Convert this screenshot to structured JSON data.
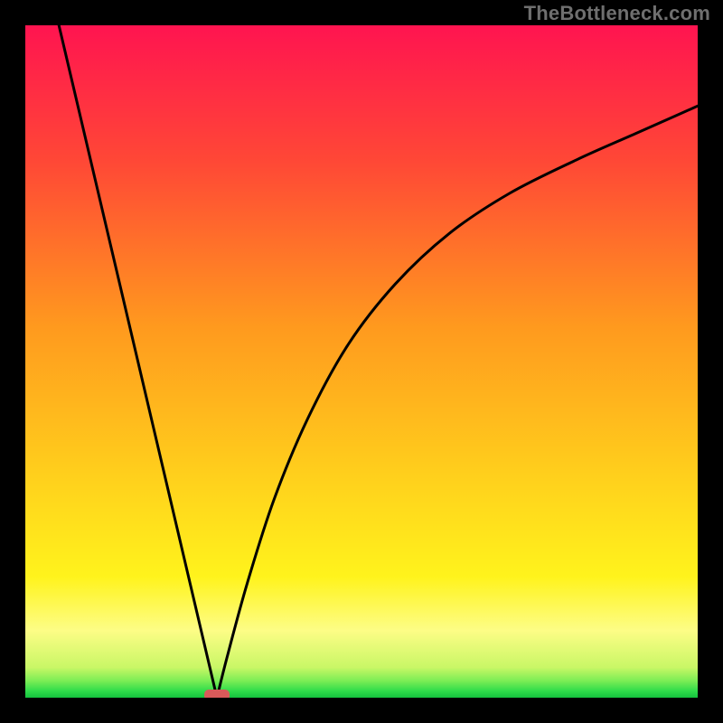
{
  "watermark": "TheBottleneck.com",
  "chart_data": {
    "type": "line",
    "title": "",
    "xlabel": "",
    "ylabel": "",
    "xlim": [
      0,
      100
    ],
    "ylim": [
      0,
      100
    ],
    "grid": false,
    "legend": false,
    "notes": "V-shaped curve: left branch is a straight line from (~5,100) down to a minimum at x≈28; right branch rises as a concave curve approaching ~88 at x=100. Background is a vertical gradient red→orange→yellow→green with a thin green band at the very bottom. A small red rounded marker sits at the minimum.",
    "marker": {
      "x": 28.5,
      "y": 0,
      "color": "#d95a5a"
    },
    "gradient_stops": [
      {
        "offset": 0.0,
        "color": "#ff1450"
      },
      {
        "offset": 0.2,
        "color": "#ff4736"
      },
      {
        "offset": 0.45,
        "color": "#ff9a1e"
      },
      {
        "offset": 0.68,
        "color": "#ffd21c"
      },
      {
        "offset": 0.82,
        "color": "#fff31c"
      },
      {
        "offset": 0.9,
        "color": "#fdfd86"
      },
      {
        "offset": 0.955,
        "color": "#c9f766"
      },
      {
        "offset": 0.975,
        "color": "#7bed55"
      },
      {
        "offset": 0.99,
        "color": "#2fdc4a"
      },
      {
        "offset": 1.0,
        "color": "#14c23e"
      }
    ],
    "series": [
      {
        "name": "curve",
        "x": [
          5.0,
          10.0,
          15.0,
          20.0,
          25.0,
          27.0,
          28.5,
          30.0,
          33.0,
          37.0,
          42.0,
          48.0,
          55.0,
          63.0,
          72.0,
          82.0,
          91.0,
          100.0
        ],
        "y": [
          100.0,
          78.7,
          57.4,
          36.2,
          14.9,
          6.4,
          0.0,
          6.0,
          17.0,
          29.5,
          41.5,
          52.5,
          61.5,
          69.0,
          75.0,
          80.0,
          84.0,
          88.0
        ]
      }
    ]
  }
}
